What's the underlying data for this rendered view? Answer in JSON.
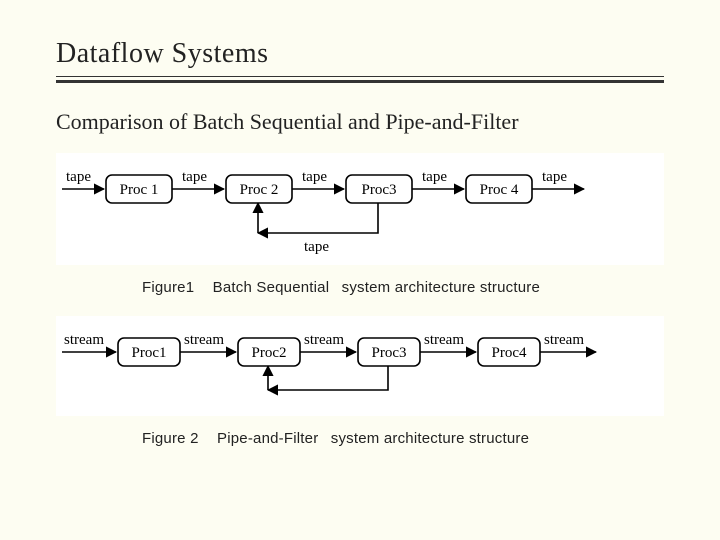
{
  "slide": {
    "title": "Dataflow Systems",
    "subhead": "Comparison of Batch Sequential and Pipe-and-Filter"
  },
  "fig1": {
    "figno": "Figure1",
    "type": "Batch Sequential",
    "rest": "system  architecture  structure",
    "edge_label": "tape",
    "nodes": [
      "Proc 1",
      "Proc 2",
      "Proc3",
      "Proc 4"
    ],
    "feedback_label": "tape",
    "feedback_from": 3,
    "feedback_to": 2
  },
  "fig2": {
    "figno": "Figure 2",
    "type": "Pipe-and-Filter",
    "rest": "system  architecture  structure",
    "edge_label": "stream",
    "nodes": [
      "Proc1",
      "Proc2",
      "Proc3",
      "Proc4"
    ],
    "feedback_label": "",
    "feedback_from": 3,
    "feedback_to": 2
  }
}
